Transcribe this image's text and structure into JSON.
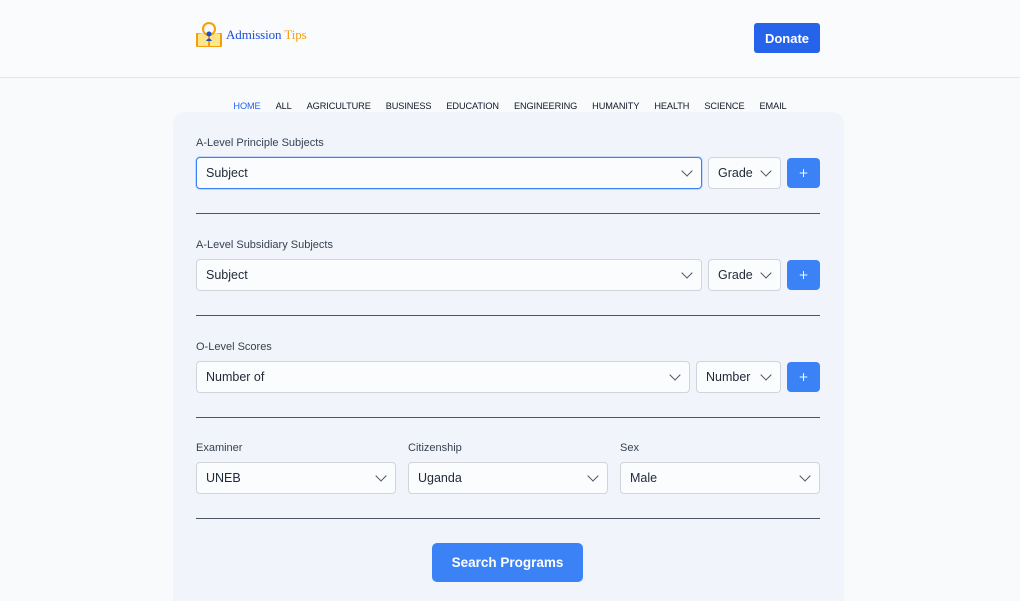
{
  "header": {
    "logo_word1": "Admission",
    "logo_word2": "Tips",
    "donate_label": "Donate"
  },
  "nav": {
    "items": [
      "HOME",
      "ALL",
      "AGRICULTURE",
      "BUSINESS",
      "EDUCATION",
      "ENGINEERING",
      "HUMANITY",
      "HEALTH",
      "SCIENCE",
      "EMAIL"
    ],
    "active": "HOME"
  },
  "form": {
    "principal": {
      "label": "A-Level Principle Subjects",
      "subject": "Subject",
      "grade": "Grade",
      "add": "+"
    },
    "subsidiary": {
      "label": "A-Level Subsidiary Subjects",
      "subject": "Subject",
      "grade": "Grade",
      "add": "+"
    },
    "olevel": {
      "label": "O-Level Scores",
      "number_of": "Number of",
      "number": "Number",
      "add": "+"
    },
    "examiner": {
      "label": "Examiner",
      "value": "UNEB"
    },
    "citizenship": {
      "label": "Citizenship",
      "value": "Uganda"
    },
    "sex": {
      "label": "Sex",
      "value": "Male"
    },
    "search_label": "Search Programs"
  },
  "colors": {
    "primary": "#2563eb",
    "button": "#3b82f6",
    "logo_blue": "#1d4ed8",
    "logo_orange": "#f59e0b"
  }
}
